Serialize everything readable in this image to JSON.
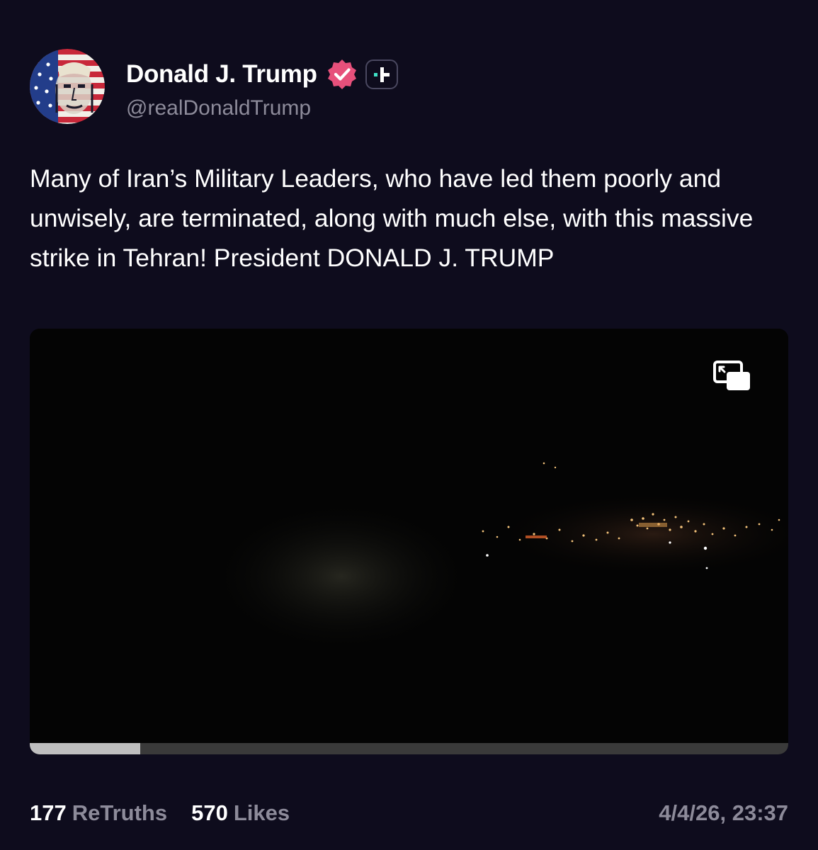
{
  "post": {
    "author": {
      "display_name": "Donald J. Trump",
      "handle": "@realDonaldTrump",
      "verified": true,
      "badge_icon": "verified-badge-icon",
      "plus_icon": "truth-plus-icon"
    },
    "text": "Many of Iran’s Military Leaders, who have led them poorly and unwisely, are terminated, along with much else, with this massive strike in Tehran! President DONALD J. TRUMP",
    "video": {
      "progress_percent": 14.6,
      "pip_icon": "picture-in-picture-icon"
    },
    "stats": {
      "retruths_count": "177",
      "retruths_label": "ReTruths",
      "likes_count": "570",
      "likes_label": "Likes"
    },
    "timestamp": "4/4/26, 23:37"
  },
  "colors": {
    "background": "#0e0c1d",
    "muted_text": "#8d8b9a",
    "verified_badge": "#e7507b",
    "truth_plus_accent": "#3fe0c5"
  }
}
